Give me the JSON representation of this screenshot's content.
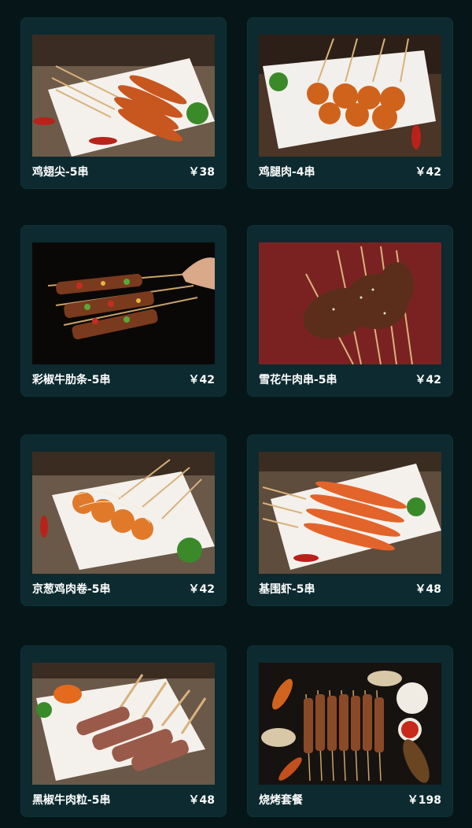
{
  "menu": {
    "items": [
      {
        "name": "鸡翅尖-5串",
        "price": "￥38"
      },
      {
        "name": "鸡腿肉-4串",
        "price": "￥42"
      },
      {
        "name": "彩椒牛肋条-5串",
        "price": "￥42"
      },
      {
        "name": "雪花牛肉串-5串",
        "price": "￥42"
      },
      {
        "name": "京葱鸡肉卷-5串",
        "price": "￥42"
      },
      {
        "name": "基围虾-5串",
        "price": "￥48"
      },
      {
        "name": "黑椒牛肉粒-5串",
        "price": "￥48"
      },
      {
        "name": "烧烤套餐",
        "price": "￥198"
      }
    ]
  },
  "colors": {
    "background": "#061618",
    "card": "#0c2a2f",
    "text": "#ffffff"
  }
}
